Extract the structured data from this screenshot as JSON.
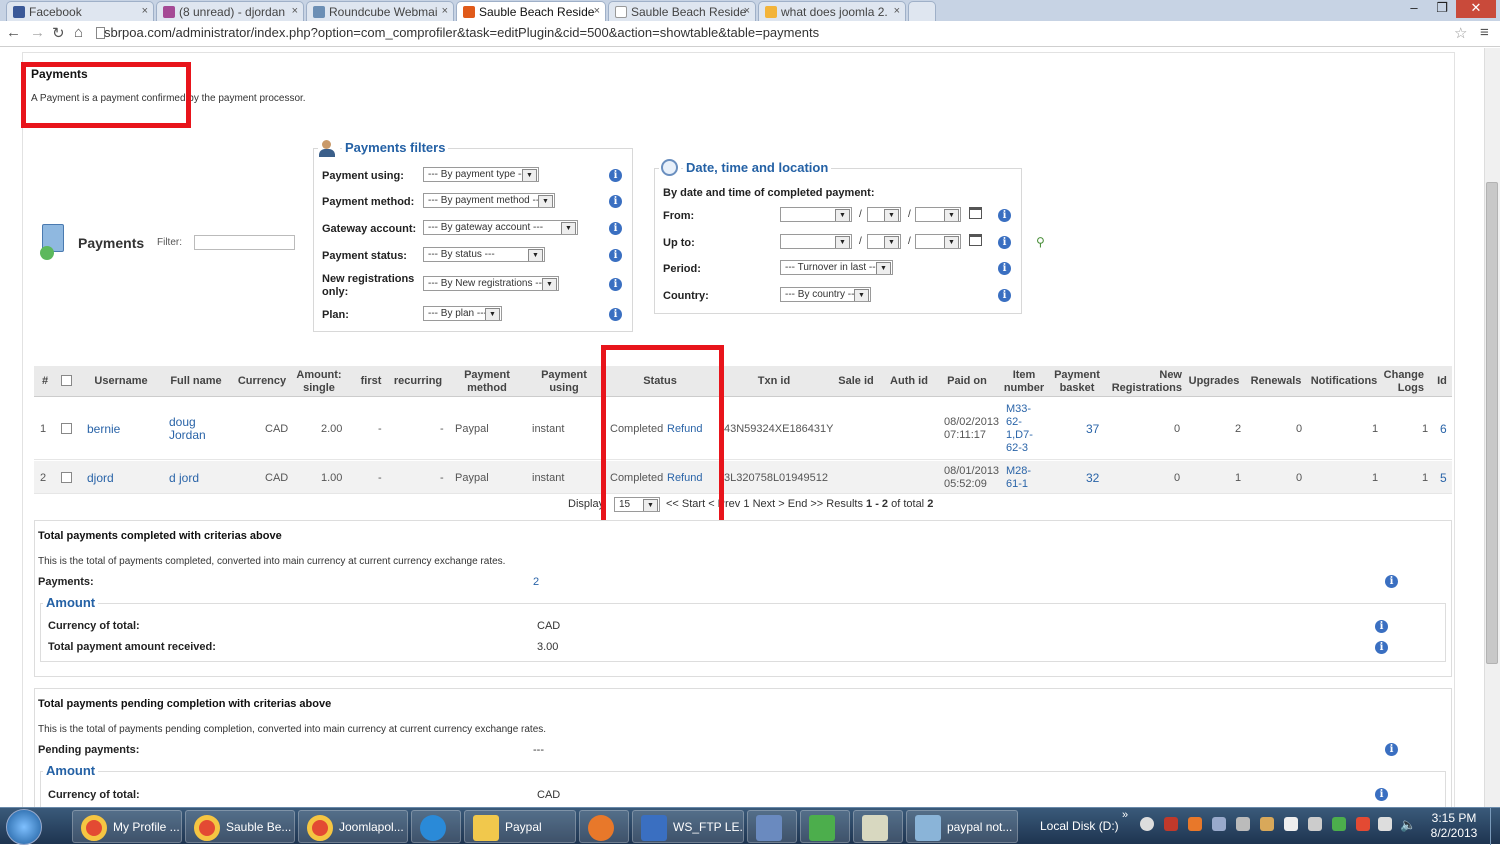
{
  "browser": {
    "tabs": [
      {
        "title": "Facebook",
        "favicon": "#3b5998"
      },
      {
        "title": "(8 unread) - djordan",
        "favicon": "#a54a95"
      },
      {
        "title": "Roundcube Webmai",
        "favicon": "#6c8fb5"
      },
      {
        "title": "Sauble Beach Reside",
        "favicon": "#e05a1a",
        "active": true
      },
      {
        "title": "Sauble Beach Reside",
        "favicon": "#ffffff"
      },
      {
        "title": "what does joomla 2.",
        "favicon": "#f3b43a"
      }
    ],
    "url": "sbrpoa.com/administrator/index.php?option=com_comprofiler&task=editPlugin&cid=500&action=showtable&table=payments"
  },
  "header": {
    "title": "Payments",
    "description": "A Payment is a payment confirmed by the payment processor."
  },
  "toolbar": {
    "title": "Payments",
    "filter_label": "Filter:"
  },
  "filters": {
    "legend": "Payments filters",
    "items": [
      {
        "label": "Payment using:",
        "value": "--- By payment type ---"
      },
      {
        "label": "Payment method:",
        "value": "--- By payment method ---"
      },
      {
        "label": "Gateway account:",
        "value": "--- By gateway account ---"
      },
      {
        "label": "Payment status:",
        "value": "--- By status ---"
      },
      {
        "label": "New registrations only:",
        "value": "--- By New registrations ---"
      },
      {
        "label": "Plan:",
        "value": "--- By plan ---"
      }
    ]
  },
  "date_filters": {
    "legend": "Date, time and location",
    "subtitle": "By date and time of completed payment:",
    "from_label": "From:",
    "upto_label": "Up to:",
    "period_label": "Period:",
    "period_value": "--- Turnover in last ---",
    "country_label": "Country:",
    "country_value": "--- By country ---",
    "sep": "/"
  },
  "table": {
    "columns": [
      "#",
      "Username",
      "Full name",
      "Currency",
      "Amount: single",
      "first",
      "recurring",
      "Payment method",
      "Payment using",
      "Status",
      "Txn id",
      "Sale id",
      "Auth id",
      "Paid on",
      "Item number",
      "Payment basket",
      "New Registrations",
      "Upgrades",
      "Renewals",
      "Notifications",
      "Change Logs",
      "Id"
    ],
    "rows": [
      {
        "num": "1",
        "username": "bernie",
        "fullname": "doug Jordan",
        "currency": "CAD",
        "amount": "2.00",
        "first": "-",
        "recurring": "-",
        "method": "Paypal",
        "using": "instant",
        "status": "Completed",
        "action": "Refund",
        "txn": "43N59324XE186431Y",
        "paid": "08/02/2013 07:11:17",
        "item": "M33-62-1,D7-62-3",
        "basket": "37",
        "newreg": "0",
        "upgrades": "2",
        "renewals": "0",
        "notifications": "1",
        "changelogs": "1",
        "id": "6"
      },
      {
        "num": "2",
        "username": "djord",
        "fullname": "d jord",
        "currency": "CAD",
        "amount": "1.00",
        "first": "-",
        "recurring": "-",
        "method": "Paypal",
        "using": "instant",
        "status": "Completed",
        "action": "Refund",
        "txn": "3L320758L01949512",
        "paid": "08/01/2013 05:52:09",
        "item": "M28-61-1",
        "basket": "32",
        "newreg": "0",
        "upgrades": "1",
        "renewals": "0",
        "notifications": "1",
        "changelogs": "1",
        "id": "5"
      }
    ]
  },
  "pagination": {
    "display_label": "Display",
    "display_value": "15",
    "start": "<< Start",
    "prev": "< Prev",
    "page": "1",
    "next": "Next >",
    "end": "End >>",
    "results_prefix": "Results",
    "results_range": "1 - 2",
    "results_of": "of total",
    "results_total": "2"
  },
  "completed": {
    "title": "Total payments completed with criterias above",
    "desc": "This is the total of payments completed, converted into main currency at current currency exchange rates.",
    "count_label": "Payments:",
    "count_value": "2",
    "amount_legend": "Amount",
    "currency_label": "Currency of total:",
    "currency_value": "CAD",
    "total_label": "Total payment amount received:",
    "total_value": "3.00"
  },
  "pending": {
    "title": "Total payments pending completion with criterias above",
    "desc": "This is the total of payments pending completion, converted into main currency at current currency exchange rates.",
    "count_label": "Pending payments:",
    "count_value": "---",
    "amount_legend": "Amount",
    "currency_label": "Currency of total:",
    "currency_value": "CAD"
  },
  "taskbar": {
    "items": [
      {
        "label": "My Profile ...",
        "color": "#e34a33"
      },
      {
        "label": "Sauble Be...",
        "color": "#e34a33"
      },
      {
        "label": "Joomlapol...",
        "color": "#e34a33"
      },
      {
        "label": "",
        "color": "#2a8ad8"
      },
      {
        "label": "Paypal",
        "color": "#f1c84c"
      },
      {
        "label": "",
        "color": "#e8782a"
      },
      {
        "label": "WS_FTP LE...",
        "color": "#3a6fc1"
      },
      {
        "label": "",
        "color": "#6a8abf"
      },
      {
        "label": "",
        "color": "#4cae4c"
      },
      {
        "label": "",
        "color": "#d8d8c0"
      },
      {
        "label": "paypal not...",
        "color": "#8ab4d8"
      }
    ],
    "local_disk": "Local Disk (D:)",
    "time": "3:15 PM",
    "date": "8/2/2013"
  },
  "colors": {
    "accent": "#2461a5",
    "highlight": "#e8141b"
  }
}
